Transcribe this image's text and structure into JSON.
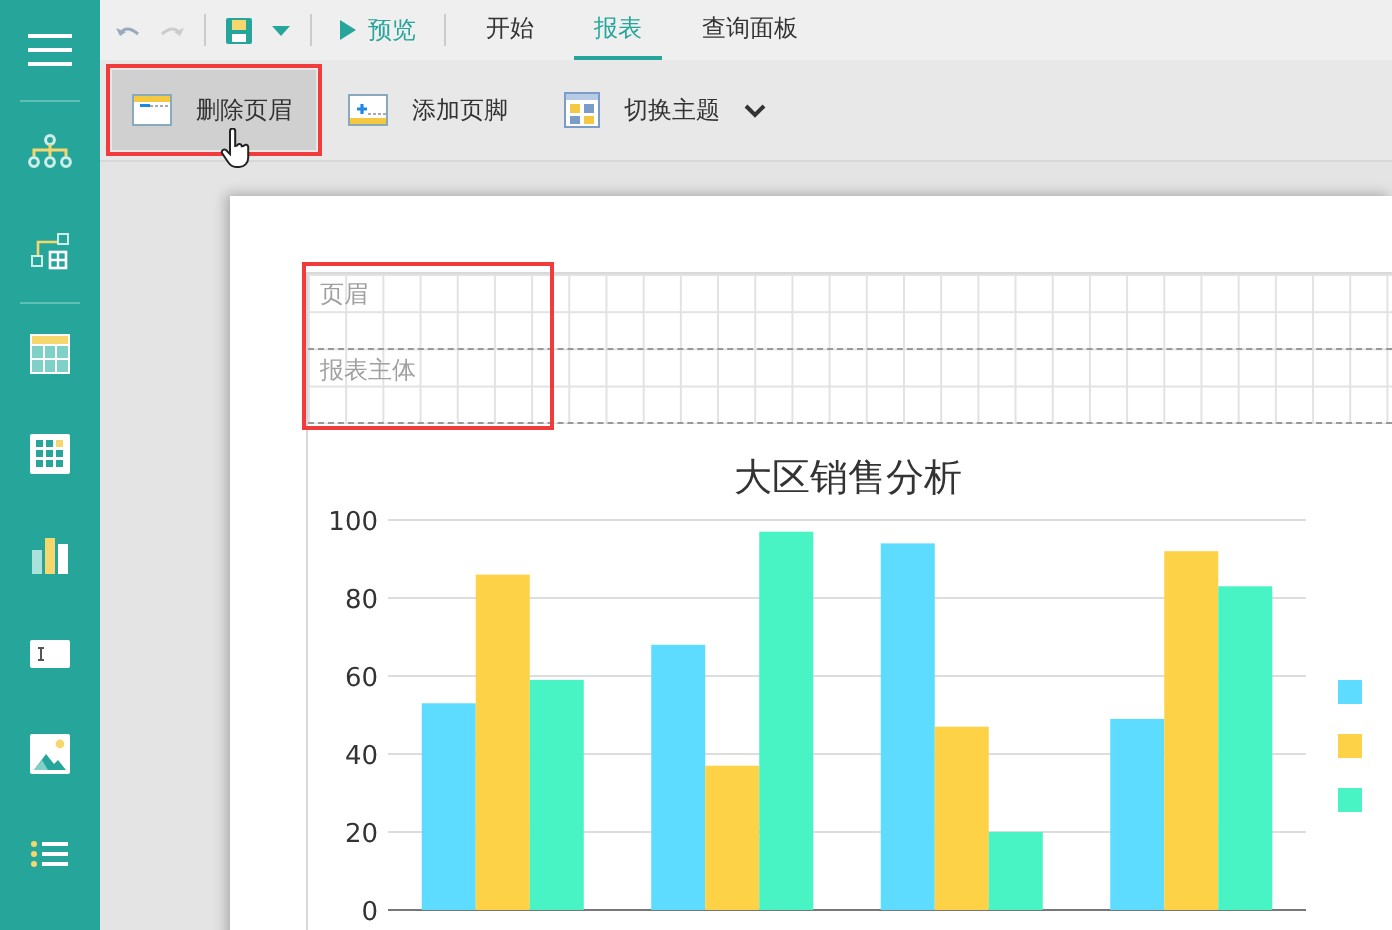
{
  "sidebar": {
    "items": [
      {
        "kind": "menu"
      },
      {
        "kind": "org"
      },
      {
        "kind": "nodes"
      },
      {
        "kind": "table"
      },
      {
        "kind": "grid"
      },
      {
        "kind": "bars"
      },
      {
        "kind": "text"
      },
      {
        "kind": "image"
      },
      {
        "kind": "list"
      }
    ]
  },
  "quick_bar": {
    "preview": "预览",
    "tabs": [
      {
        "label": "开始",
        "selected": false
      },
      {
        "label": "报表",
        "selected": true
      },
      {
        "label": "查询面板",
        "selected": false
      }
    ]
  },
  "ribbon": {
    "buttons": [
      {
        "kind": "remove_header",
        "label": "删除页眉",
        "highlighted": true
      },
      {
        "kind": "add_footer",
        "label": "添加页脚",
        "highlighted": false
      },
      {
        "kind": "theme",
        "label": "切换主题",
        "highlighted": false
      }
    ]
  },
  "report_bands": {
    "highlighted": true,
    "items": [
      {
        "label": "页眉"
      },
      {
        "label": "报表主体"
      }
    ]
  },
  "chart_data": {
    "type": "bar",
    "grid": true,
    "title": "大区销售分析",
    "ylim": [
      0,
      100
    ],
    "yticks": [
      0,
      20,
      40,
      60,
      80,
      100
    ],
    "series": [
      {
        "color": "#5ddcff",
        "values": [
          53,
          68,
          94,
          49
        ]
      },
      {
        "color": "#fed247",
        "values": [
          86,
          37,
          47,
          92
        ]
      },
      {
        "color": "#48f4c4",
        "values": [
          59,
          97,
          20,
          83
        ]
      }
    ]
  }
}
